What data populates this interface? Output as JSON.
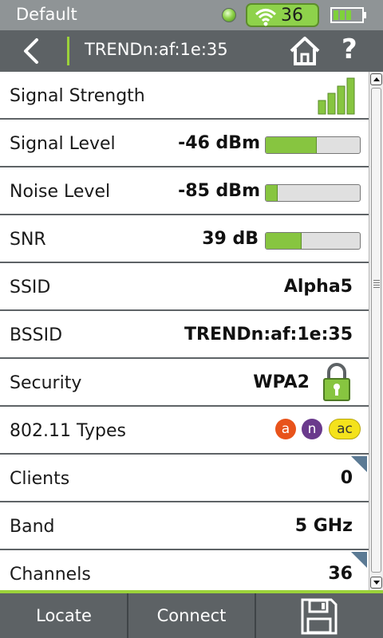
{
  "status_bar": {
    "profile_name": "Default",
    "wifi_channel": "36"
  },
  "nav": {
    "title": "TRENDn:af:1e:35",
    "help_label": "?"
  },
  "rows": {
    "signal_strength": {
      "label": "Signal Strength",
      "bars_lit": 4,
      "bars_total": 4
    },
    "signal_level": {
      "label": "Signal Level",
      "value": "-46 dBm",
      "bar_fraction": 0.54
    },
    "noise_level": {
      "label": "Noise Level",
      "value": "-85 dBm",
      "bar_fraction": 0.13
    },
    "snr": {
      "label": "SNR",
      "value": "39 dB",
      "bar_fraction": 0.38
    },
    "ssid": {
      "label": "SSID",
      "value": "Alpha5"
    },
    "bssid": {
      "label": "BSSID",
      "value": "TRENDn:af:1e:35"
    },
    "security": {
      "label": "Security",
      "value": "WPA2"
    },
    "types": {
      "label": "802.11 Types",
      "badges": [
        "a",
        "n",
        "ac"
      ]
    },
    "clients": {
      "label": "Clients",
      "value": "0"
    },
    "band": {
      "label": "Band",
      "value": "5 GHz"
    },
    "channels": {
      "label": "Channels",
      "value": "36"
    }
  },
  "toolbar": {
    "locate_label": "Locate",
    "connect_label": "Connect"
  },
  "colors": {
    "accent_green": "#9bd23a",
    "bar_green": "#87c540",
    "header_gray": "#5d6265",
    "status_gray": "#8f9496",
    "badge_a": "#e8531b",
    "badge_n": "#6a3a8c",
    "badge_ac": "#f4e21c"
  }
}
